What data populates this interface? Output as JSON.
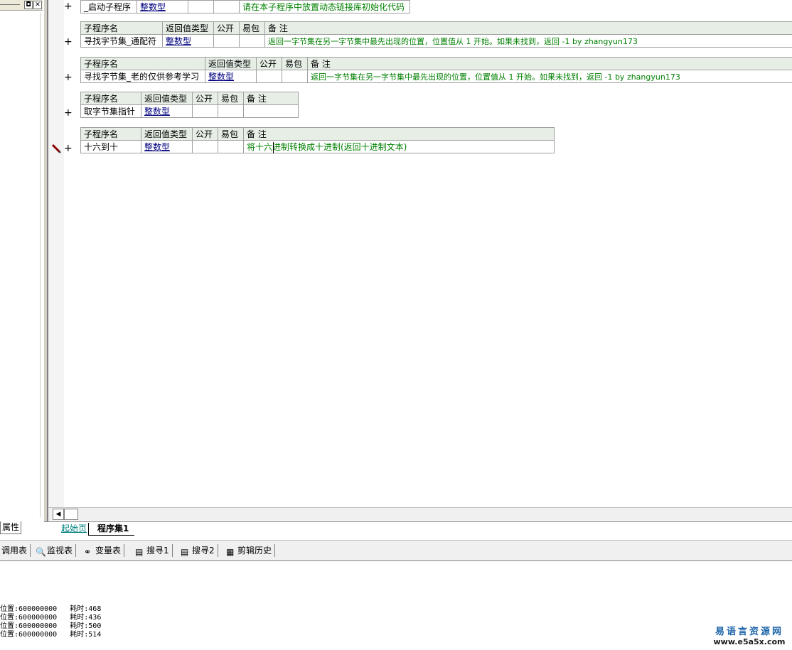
{
  "left_panel": {
    "properties_tab": "属性",
    "pin_glyph": "◘",
    "close_glyph": "✕"
  },
  "gutter": {
    "plus": "+",
    "pencil": "edit-marker"
  },
  "blocks": [
    {
      "headers": null,
      "row": {
        "name": "_启动子程序",
        "type": "整数型",
        "public": "",
        "easy": "",
        "note": "请在本子程序中放置动态链接库初始化代码"
      }
    },
    {
      "headers": {
        "name": "子程序名",
        "type": "返回值类型",
        "public": "公开",
        "easy": "易包",
        "note": "备 注"
      },
      "row": {
        "name": "寻找字节集_通配符",
        "type": "整数型",
        "public": "",
        "easy": "",
        "note": "返回一字节集在另一字节集中最先出现的位置，位置值从 1 开始。如果未找到，返回 -1  by zhangyun173"
      }
    },
    {
      "headers": {
        "name": "子程序名",
        "type": "返回值类型",
        "public": "公开",
        "easy": "易包",
        "note": "备 注"
      },
      "row": {
        "name": "寻找字节集_老的仅供参考学习",
        "type": "整数型",
        "public": "",
        "easy": "",
        "note": "返回一字节集在另一字节集中最先出现的位置，位置值从 1 开始。如果未找到，返回 -1 by zhangyun173"
      }
    },
    {
      "headers": {
        "name": "子程序名",
        "type": "返回值类型",
        "public": "公开",
        "easy": "易包",
        "note": "备 注"
      },
      "row": {
        "name": "取字节集指针",
        "type": "整数型",
        "public": "",
        "easy": "",
        "note": ""
      }
    },
    {
      "headers": {
        "name": "子程序名",
        "type": "返回值类型",
        "public": "公开",
        "easy": "易包",
        "note": "备 注"
      },
      "row": {
        "name": "十六到十",
        "type": "整数型",
        "public": "",
        "easy": "",
        "note": "将十六进制转换成十进制(返回十进制文本)"
      }
    }
  ],
  "tabs": {
    "start": "起始页",
    "program": "程序集1"
  },
  "toolbar": [
    {
      "label": "调用表",
      "icon": "call-table-icon",
      "glyph": ""
    },
    {
      "label": "监视表",
      "icon": "magnifier-icon",
      "glyph": "🔍"
    },
    {
      "label": "变量表",
      "icon": "variables-icon",
      "glyph": "⚭"
    },
    {
      "label": "搜寻1",
      "icon": "search1-icon",
      "glyph": "▤"
    },
    {
      "label": "搜寻2",
      "icon": "search2-icon",
      "glyph": "▤"
    },
    {
      "label": "剪辑历史",
      "icon": "clipboard-icon",
      "glyph": "▦"
    }
  ],
  "output_lines": [
    "位置:600000000   耗时:468",
    "位置:600000000   耗时:436",
    "位置:600000000   耗时:500",
    "位置:600000000   耗时:514"
  ],
  "watermark": {
    "top": "易语言资源网",
    "bottom": "www.e5a5x.com"
  },
  "colors": {
    "header_bg": "#e6eee6",
    "type_color": "#000080",
    "note_color": "#008000",
    "tab_start_color": "#008080"
  }
}
